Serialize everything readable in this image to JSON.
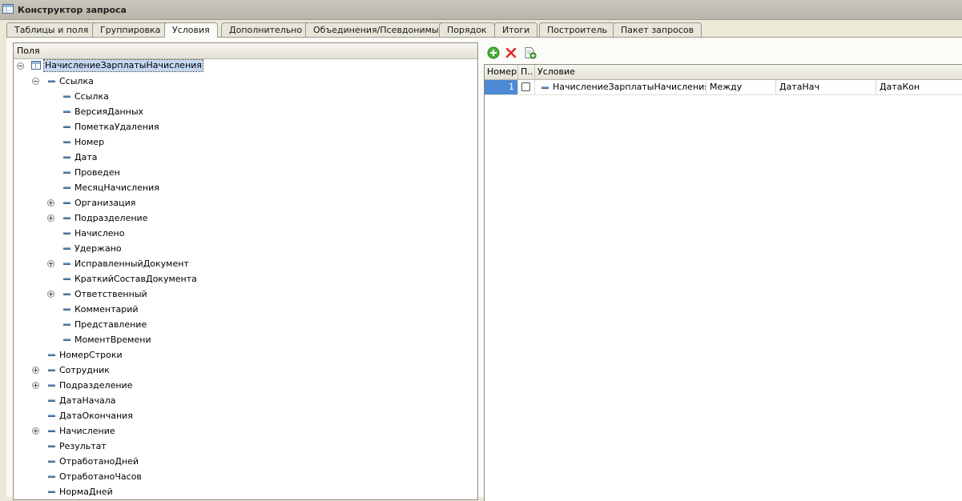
{
  "window": {
    "title": "Конструктор запроса"
  },
  "tabs": [
    {
      "label": "Таблицы и поля",
      "active": false
    },
    {
      "label": "Группировка",
      "active": false
    },
    {
      "label": "Условия",
      "active": true
    },
    {
      "label": "Дополнительно",
      "active": false
    },
    {
      "label": "Объединения/Псевдонимы",
      "active": false
    },
    {
      "label": "Порядок",
      "active": false
    },
    {
      "label": "Итоги",
      "active": false
    },
    {
      "label": "Построитель",
      "active": false
    },
    {
      "label": "Пакет запросов",
      "active": false
    }
  ],
  "fields_panel": {
    "header": "Поля",
    "tree": [
      {
        "label": "НачислениеЗарплатыНачисления",
        "level": 0,
        "expander": "minus",
        "icon": "table-icon",
        "selected": true
      },
      {
        "label": "Ссылка",
        "level": 1,
        "expander": "minus",
        "icon": "field-icon"
      },
      {
        "label": "Ссылка",
        "level": 2,
        "expander": "none",
        "icon": "field-icon"
      },
      {
        "label": "ВерсияДанных",
        "level": 2,
        "expander": "none",
        "icon": "field-icon"
      },
      {
        "label": "ПометкаУдаления",
        "level": 2,
        "expander": "none",
        "icon": "field-icon"
      },
      {
        "label": "Номер",
        "level": 2,
        "expander": "none",
        "icon": "field-icon"
      },
      {
        "label": "Дата",
        "level": 2,
        "expander": "none",
        "icon": "field-icon"
      },
      {
        "label": "Проведен",
        "level": 2,
        "expander": "none",
        "icon": "field-icon"
      },
      {
        "label": "МесяцНачисления",
        "level": 2,
        "expander": "none",
        "icon": "field-icon"
      },
      {
        "label": "Организация",
        "level": 2,
        "expander": "plus",
        "icon": "field-icon"
      },
      {
        "label": "Подразделение",
        "level": 2,
        "expander": "plus",
        "icon": "field-icon"
      },
      {
        "label": "Начислено",
        "level": 2,
        "expander": "none",
        "icon": "field-icon"
      },
      {
        "label": "Удержано",
        "level": 2,
        "expander": "none",
        "icon": "field-icon"
      },
      {
        "label": "ИсправленныйДокумент",
        "level": 2,
        "expander": "plus",
        "icon": "field-icon"
      },
      {
        "label": "КраткийСоставДокумента",
        "level": 2,
        "expander": "none",
        "icon": "field-icon"
      },
      {
        "label": "Ответственный",
        "level": 2,
        "expander": "plus",
        "icon": "field-icon"
      },
      {
        "label": "Комментарий",
        "level": 2,
        "expander": "none",
        "icon": "field-icon"
      },
      {
        "label": "Представление",
        "level": 2,
        "expander": "none",
        "icon": "field-icon"
      },
      {
        "label": "МоментВремени",
        "level": 2,
        "expander": "none",
        "icon": "field-icon"
      },
      {
        "label": "НомерСтроки",
        "level": 1,
        "expander": "none",
        "icon": "field-icon"
      },
      {
        "label": "Сотрудник",
        "level": 1,
        "expander": "plus",
        "icon": "field-icon"
      },
      {
        "label": "Подразделение",
        "level": 1,
        "expander": "plus",
        "icon": "field-icon"
      },
      {
        "label": "ДатаНачала",
        "level": 1,
        "expander": "none",
        "icon": "field-icon"
      },
      {
        "label": "ДатаОкончания",
        "level": 1,
        "expander": "none",
        "icon": "field-icon"
      },
      {
        "label": "Начисление",
        "level": 1,
        "expander": "plus",
        "icon": "field-icon"
      },
      {
        "label": "Результат",
        "level": 1,
        "expander": "none",
        "icon": "field-icon"
      },
      {
        "label": "ОтработаноДней",
        "level": 1,
        "expander": "none",
        "icon": "field-icon"
      },
      {
        "label": "ОтработаноЧасов",
        "level": 1,
        "expander": "none",
        "icon": "field-icon"
      },
      {
        "label": "НормаДней",
        "level": 1,
        "expander": "none",
        "icon": "field-icon"
      }
    ]
  },
  "conditions_panel": {
    "toolbar": [
      "add-icon",
      "delete-icon",
      "edit-icon"
    ],
    "columns": [
      "Номер",
      "П..",
      "Условие"
    ],
    "rows": [
      {
        "number": "1",
        "checked": false,
        "field": "НачислениеЗарплатыНачисления....",
        "operator": "Между",
        "from": "ДатаНач",
        "to": "ДатаКон"
      }
    ]
  },
  "colors": {
    "tab_bg": "#e8e6da",
    "active_tab_bg": "#fbfbf8",
    "selection": "#c4d8f2",
    "row_number_bg": "#4d8ad6",
    "field_icon": "#5f86b3"
  }
}
